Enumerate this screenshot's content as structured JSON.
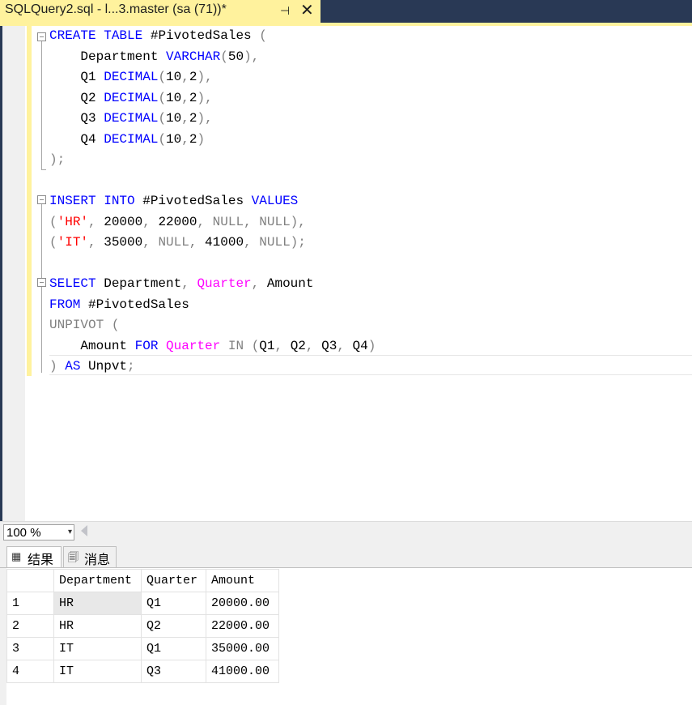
{
  "tab": {
    "title": "SQLQuery2.sql - l...3.master (sa (71))*",
    "pin_glyph": "⊣",
    "close_glyph": "✕"
  },
  "code_lines": [
    [
      {
        "t": "CREATE",
        "c": "kw"
      },
      {
        "t": " "
      },
      {
        "t": "TABLE",
        "c": "kw"
      },
      {
        "t": " #PivotedSales "
      },
      {
        "t": "(",
        "c": "gray"
      }
    ],
    [
      {
        "t": "    Department "
      },
      {
        "t": "VARCHAR",
        "c": "kw"
      },
      {
        "t": "(",
        "c": "gray"
      },
      {
        "t": "50"
      },
      {
        "t": "),",
        "c": "gray"
      }
    ],
    [
      {
        "t": "    Q1 "
      },
      {
        "t": "DECIMAL",
        "c": "kw"
      },
      {
        "t": "(",
        "c": "gray"
      },
      {
        "t": "10"
      },
      {
        "t": ",",
        "c": "gray"
      },
      {
        "t": "2"
      },
      {
        "t": "),",
        "c": "gray"
      }
    ],
    [
      {
        "t": "    Q2 "
      },
      {
        "t": "DECIMAL",
        "c": "kw"
      },
      {
        "t": "(",
        "c": "gray"
      },
      {
        "t": "10"
      },
      {
        "t": ",",
        "c": "gray"
      },
      {
        "t": "2"
      },
      {
        "t": "),",
        "c": "gray"
      }
    ],
    [
      {
        "t": "    Q3 "
      },
      {
        "t": "DECIMAL",
        "c": "kw"
      },
      {
        "t": "(",
        "c": "gray"
      },
      {
        "t": "10"
      },
      {
        "t": ",",
        "c": "gray"
      },
      {
        "t": "2"
      },
      {
        "t": "),",
        "c": "gray"
      }
    ],
    [
      {
        "t": "    Q4 "
      },
      {
        "t": "DECIMAL",
        "c": "kw"
      },
      {
        "t": "(",
        "c": "gray"
      },
      {
        "t": "10"
      },
      {
        "t": ",",
        "c": "gray"
      },
      {
        "t": "2"
      },
      {
        "t": ")",
        "c": "gray"
      }
    ],
    [
      {
        "t": ");",
        "c": "gray"
      }
    ],
    [],
    [
      {
        "t": "INSERT",
        "c": "kw"
      },
      {
        "t": " "
      },
      {
        "t": "INTO",
        "c": "kw"
      },
      {
        "t": " #PivotedSales "
      },
      {
        "t": "VALUES",
        "c": "kw"
      }
    ],
    [
      {
        "t": "(",
        "c": "gray"
      },
      {
        "t": "'HR'",
        "c": "str"
      },
      {
        "t": ", ",
        "c": "gray"
      },
      {
        "t": "20000"
      },
      {
        "t": ", ",
        "c": "gray"
      },
      {
        "t": "22000"
      },
      {
        "t": ", ",
        "c": "gray"
      },
      {
        "t": "NULL",
        "c": "gray"
      },
      {
        "t": ", ",
        "c": "gray"
      },
      {
        "t": "NULL",
        "c": "gray"
      },
      {
        "t": "),",
        "c": "gray"
      }
    ],
    [
      {
        "t": "(",
        "c": "gray"
      },
      {
        "t": "'IT'",
        "c": "str"
      },
      {
        "t": ", ",
        "c": "gray"
      },
      {
        "t": "35000"
      },
      {
        "t": ", ",
        "c": "gray"
      },
      {
        "t": "NULL",
        "c": "gray"
      },
      {
        "t": ", ",
        "c": "gray"
      },
      {
        "t": "41000"
      },
      {
        "t": ", ",
        "c": "gray"
      },
      {
        "t": "NULL",
        "c": "gray"
      },
      {
        "t": ");",
        "c": "gray"
      }
    ],
    [],
    [
      {
        "t": "SELECT",
        "c": "kw"
      },
      {
        "t": " Department"
      },
      {
        "t": ", ",
        "c": "gray"
      },
      {
        "t": "Quarter",
        "c": "fn"
      },
      {
        "t": ", ",
        "c": "gray"
      },
      {
        "t": "Amount"
      }
    ],
    [
      {
        "t": "FROM",
        "c": "kw"
      },
      {
        "t": " #PivotedSales"
      }
    ],
    [
      {
        "t": "UNPIVOT",
        "c": "gray"
      },
      {
        "t": " "
      },
      {
        "t": "(",
        "c": "gray"
      }
    ],
    [
      {
        "t": "    Amount "
      },
      {
        "t": "FOR",
        "c": "kw"
      },
      {
        "t": " "
      },
      {
        "t": "Quarter",
        "c": "fn"
      },
      {
        "t": " "
      },
      {
        "t": "IN",
        "c": "gray"
      },
      {
        "t": " "
      },
      {
        "t": "(",
        "c": "gray"
      },
      {
        "t": "Q1"
      },
      {
        "t": ", ",
        "c": "gray"
      },
      {
        "t": "Q2"
      },
      {
        "t": ", ",
        "c": "gray"
      },
      {
        "t": "Q3"
      },
      {
        "t": ", ",
        "c": "gray"
      },
      {
        "t": "Q4"
      },
      {
        "t": ")",
        "c": "gray"
      }
    ],
    [
      {
        "t": ")",
        "c": "gray"
      },
      {
        "t": " "
      },
      {
        "t": "AS",
        "c": "kw"
      },
      {
        "t": " Unpvt"
      },
      {
        "t": ";",
        "c": "gray"
      }
    ]
  ],
  "zoom": {
    "value": "100 %",
    "arrow": "▾"
  },
  "result_tabs": {
    "results_icon": "▦",
    "results_label": "结果",
    "messages_icon": "🗐",
    "messages_label": "消息"
  },
  "grid": {
    "columns": [
      "",
      "Department",
      "Quarter",
      "Amount"
    ],
    "rows": [
      [
        "1",
        "HR",
        "Q1",
        "20000.00"
      ],
      [
        "2",
        "HR",
        "Q2",
        "22000.00"
      ],
      [
        "3",
        "IT",
        "Q1",
        "35000.00"
      ],
      [
        "4",
        "IT",
        "Q3",
        "41000.00"
      ]
    ]
  },
  "colors": {
    "accent_tab": "#fff29d",
    "frame": "#293955",
    "keyword": "#0000ff",
    "function": "#ff00ff",
    "string": "#ff0000",
    "operator": "#808080"
  }
}
